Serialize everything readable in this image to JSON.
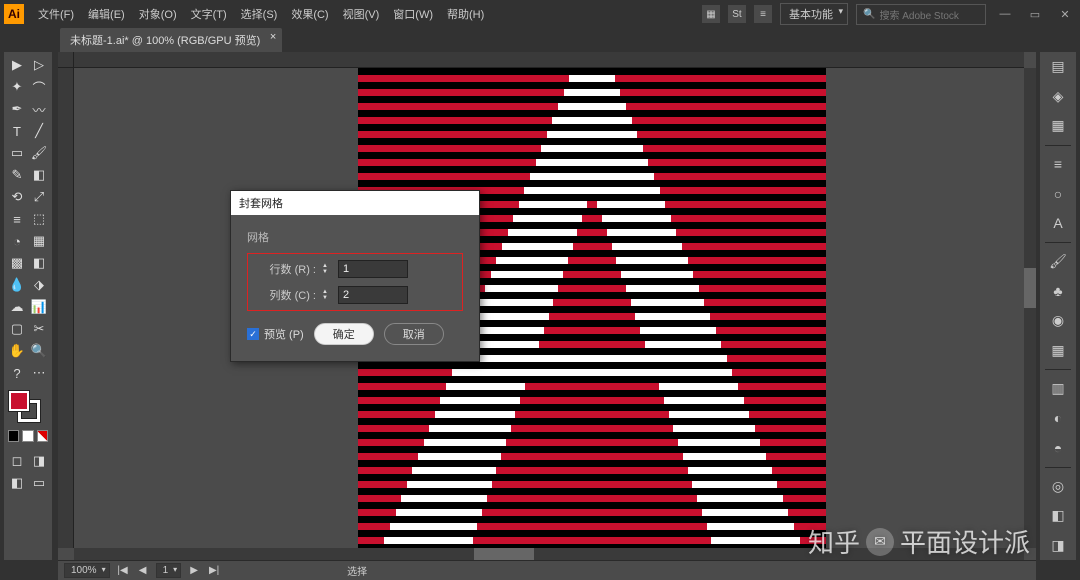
{
  "app": {
    "icon_label": "Ai"
  },
  "menu": [
    "文件(F)",
    "编辑(E)",
    "对象(O)",
    "文字(T)",
    "选择(S)",
    "效果(C)",
    "视图(V)",
    "窗口(W)",
    "帮助(H)"
  ],
  "workspace_dropdown": "基本功能",
  "search_placeholder": "搜索 Adobe Stock",
  "tab_title": "未标题-1.ai* @ 100% (RGB/GPU 预览)",
  "status": {
    "zoom": "100%",
    "artboard": "1",
    "label": "选择"
  },
  "dialog": {
    "title": "封套网格",
    "group": "网格",
    "rows_label": "行数 (R) :",
    "cols_label": "列数 (C) :",
    "rows_value": "1",
    "cols_value": "2",
    "preview": "预览 (P)",
    "ok": "确定",
    "cancel": "取消"
  },
  "watermark": {
    "brand": "知乎",
    "author": "平面设计派"
  }
}
